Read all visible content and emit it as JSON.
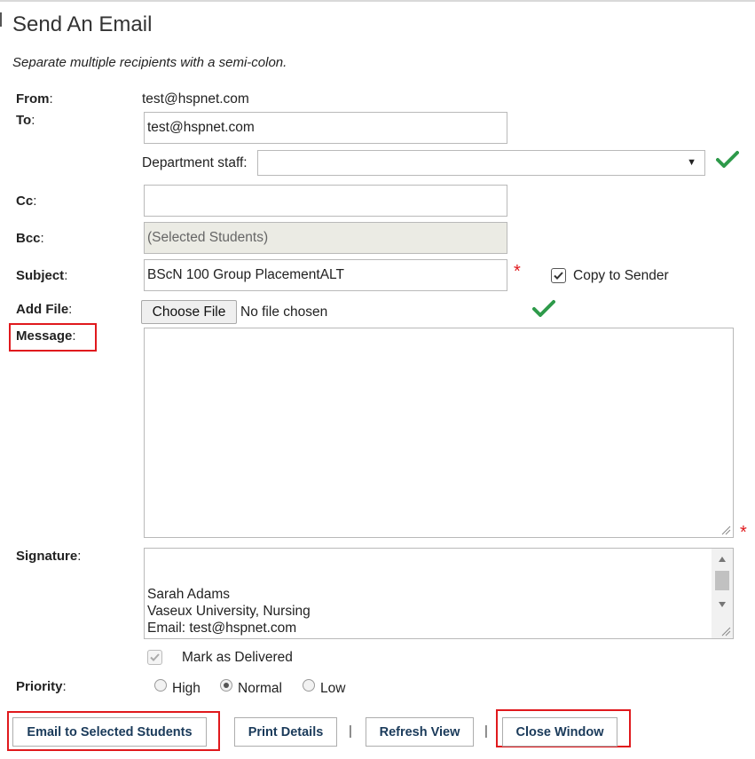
{
  "page": {
    "title": "Send An Email",
    "instruction": "Separate multiple recipients with a semi-colon."
  },
  "from": {
    "label": "From",
    "colon": ":",
    "value": "test@hspnet.com"
  },
  "to": {
    "label": "To",
    "colon": ":",
    "value": "test@hspnet.com"
  },
  "department": {
    "label": "Department staff:",
    "value": ""
  },
  "cc": {
    "label": "Cc",
    "colon": ":",
    "value": ""
  },
  "bcc": {
    "label": "Bcc",
    "colon": ":",
    "value": "(Selected Students)"
  },
  "subject": {
    "label": "Subject",
    "colon": ":",
    "value": "BScN 100 Group PlacementALT",
    "required_marker": "*",
    "copy_label": "Copy to Sender",
    "copy_checked": true
  },
  "file": {
    "label": "Add File",
    "colon": ":",
    "button": "Choose File",
    "status": "No file chosen"
  },
  "message": {
    "label": "Message",
    "colon": ":",
    "value": "",
    "required_marker": "*"
  },
  "signature": {
    "label": "Signature",
    "colon": ":",
    "lines": [
      "Sarah Adams",
      "Vaseux University, Nursing",
      "Email: test@hspnet.com"
    ]
  },
  "delivered": {
    "label": "Mark as Delivered",
    "checked": true
  },
  "priority": {
    "label": "Priority",
    "colon": ":",
    "options": [
      "High",
      "Normal",
      "Low"
    ],
    "selected": "Normal"
  },
  "buttons": {
    "email_students": "Email to Selected Students",
    "print_details": "Print Details",
    "separator": "|",
    "refresh_view": "Refresh View",
    "close_window": "Close Window"
  },
  "colors": {
    "accent_red": "#e0191d",
    "ok_green": "#2e9a4a",
    "button_text": "#1a3a5a"
  },
  "icons": {
    "valid": "checkmark-icon",
    "dropdown": "triangle-down-icon"
  }
}
